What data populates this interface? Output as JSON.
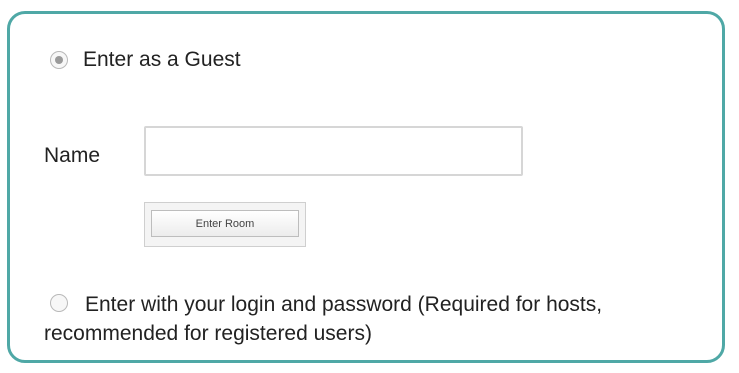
{
  "guest_option": {
    "label": "Enter as a Guest",
    "selected": true
  },
  "name_field": {
    "label": "Name",
    "value": "",
    "placeholder": ""
  },
  "enter_room_button": {
    "label": "Enter Room"
  },
  "login_option": {
    "label": "Enter with your login and password (Required for hosts, recommended for registered users)",
    "selected": false
  },
  "colors": {
    "panel_border": "#4fa8a6"
  }
}
